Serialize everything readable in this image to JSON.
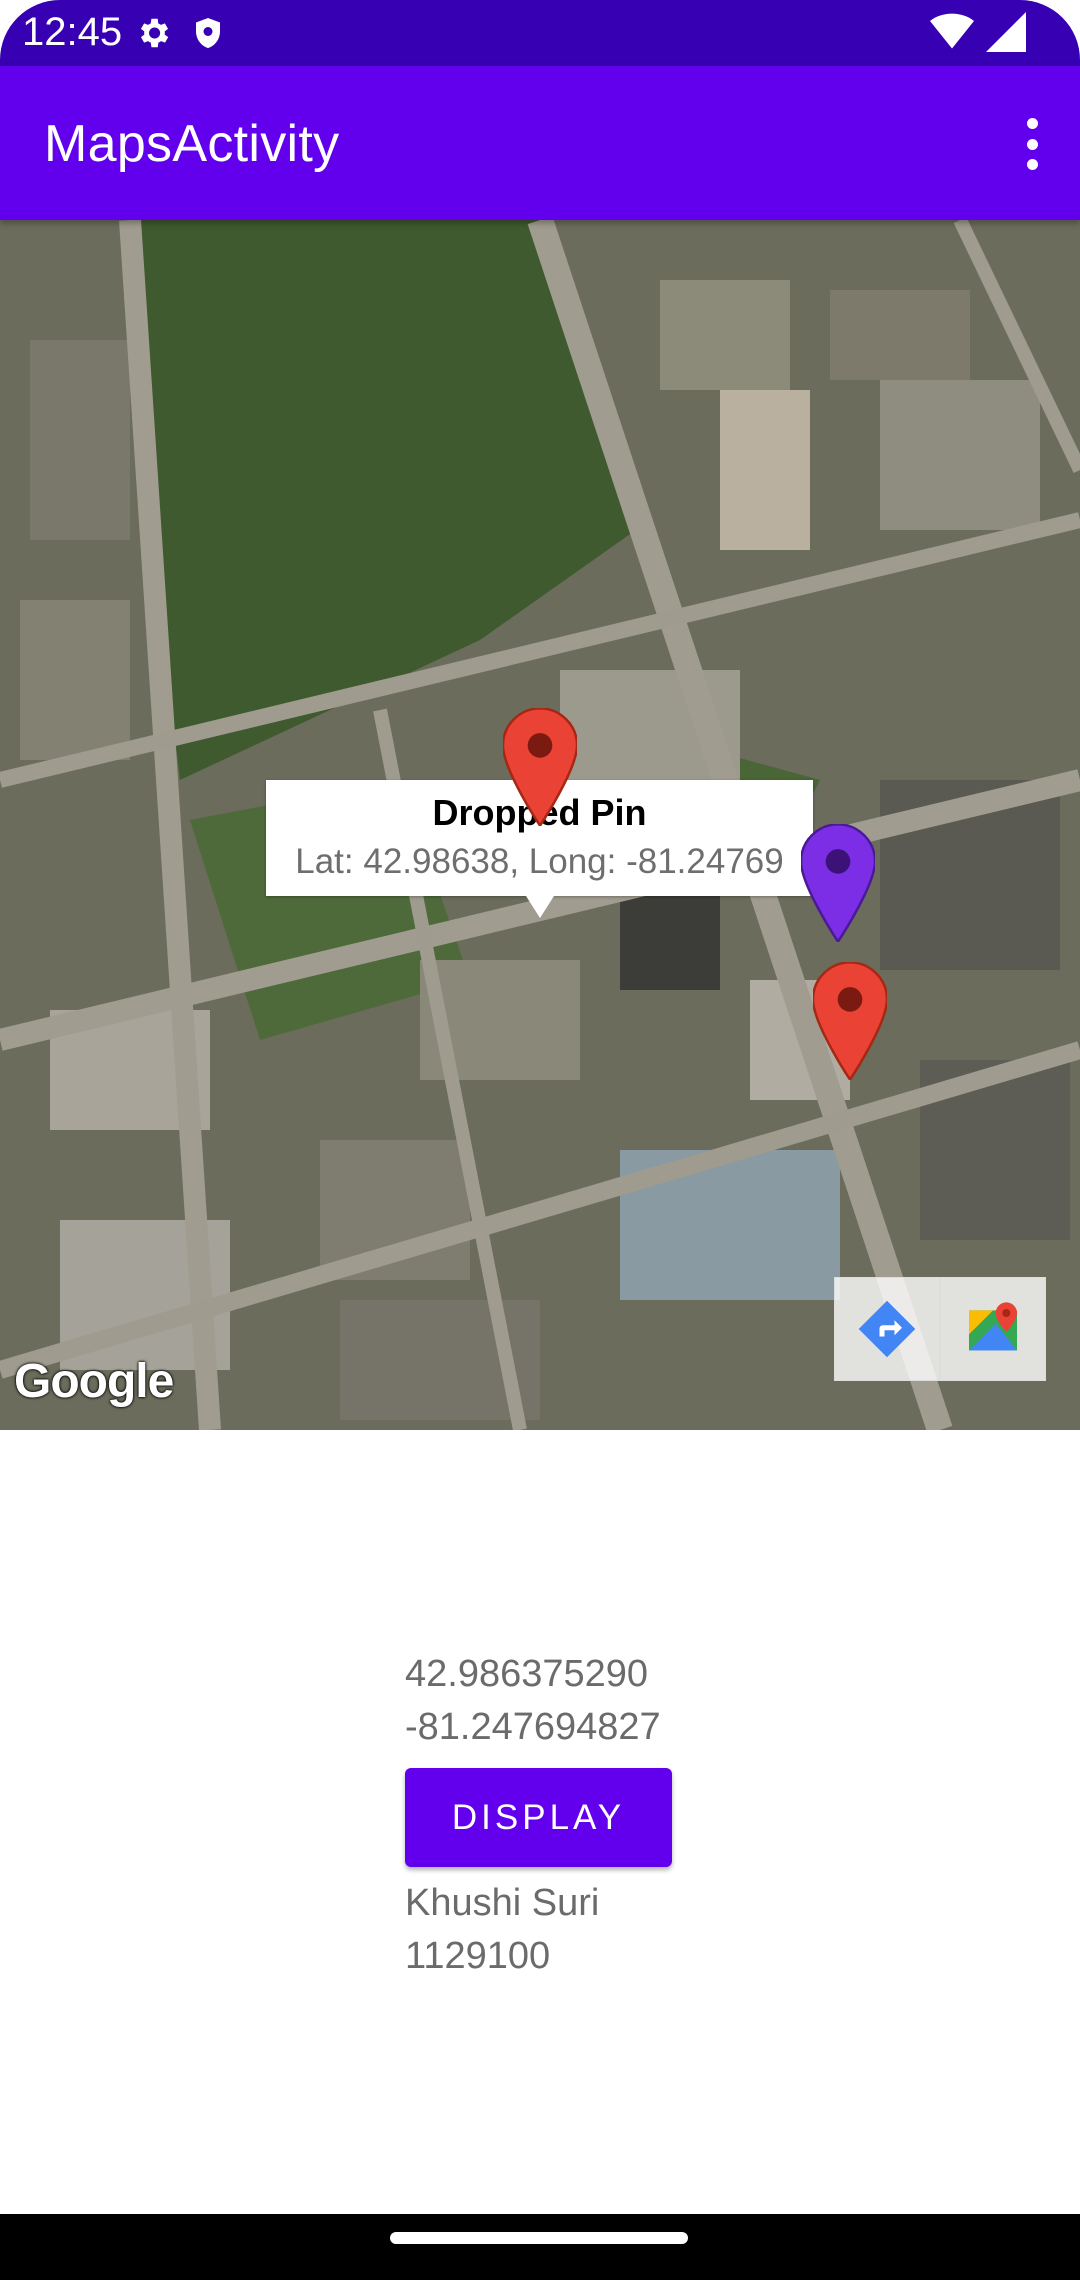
{
  "status_bar": {
    "time": "12:45",
    "left_icons": [
      "gear-icon",
      "shield-icon"
    ],
    "right_icons": [
      "wifi-icon",
      "cellular-signal-icon"
    ]
  },
  "app_bar": {
    "title": "MapsActivity",
    "overflow_icon": "more-vert-icon",
    "color": "#6200ee"
  },
  "map": {
    "type": "satellite",
    "info_window": {
      "title": "Dropped Pin",
      "snippet": "Lat: 42.98638, Long: -81.24769"
    },
    "markers": [
      {
        "color": "#ea4335",
        "selected": true
      },
      {
        "color": "#7b2ee6",
        "selected": false
      },
      {
        "color": "#ea4335",
        "selected": false
      }
    ],
    "logo_text": "Google",
    "toolbar": [
      "directions-icon",
      "google-maps-icon"
    ]
  },
  "content": {
    "latitude": "42.986375290",
    "longitude": "-81.247694827",
    "display_button": "DISPLAY",
    "name": "Khushi Suri",
    "student_id": "1129100"
  }
}
